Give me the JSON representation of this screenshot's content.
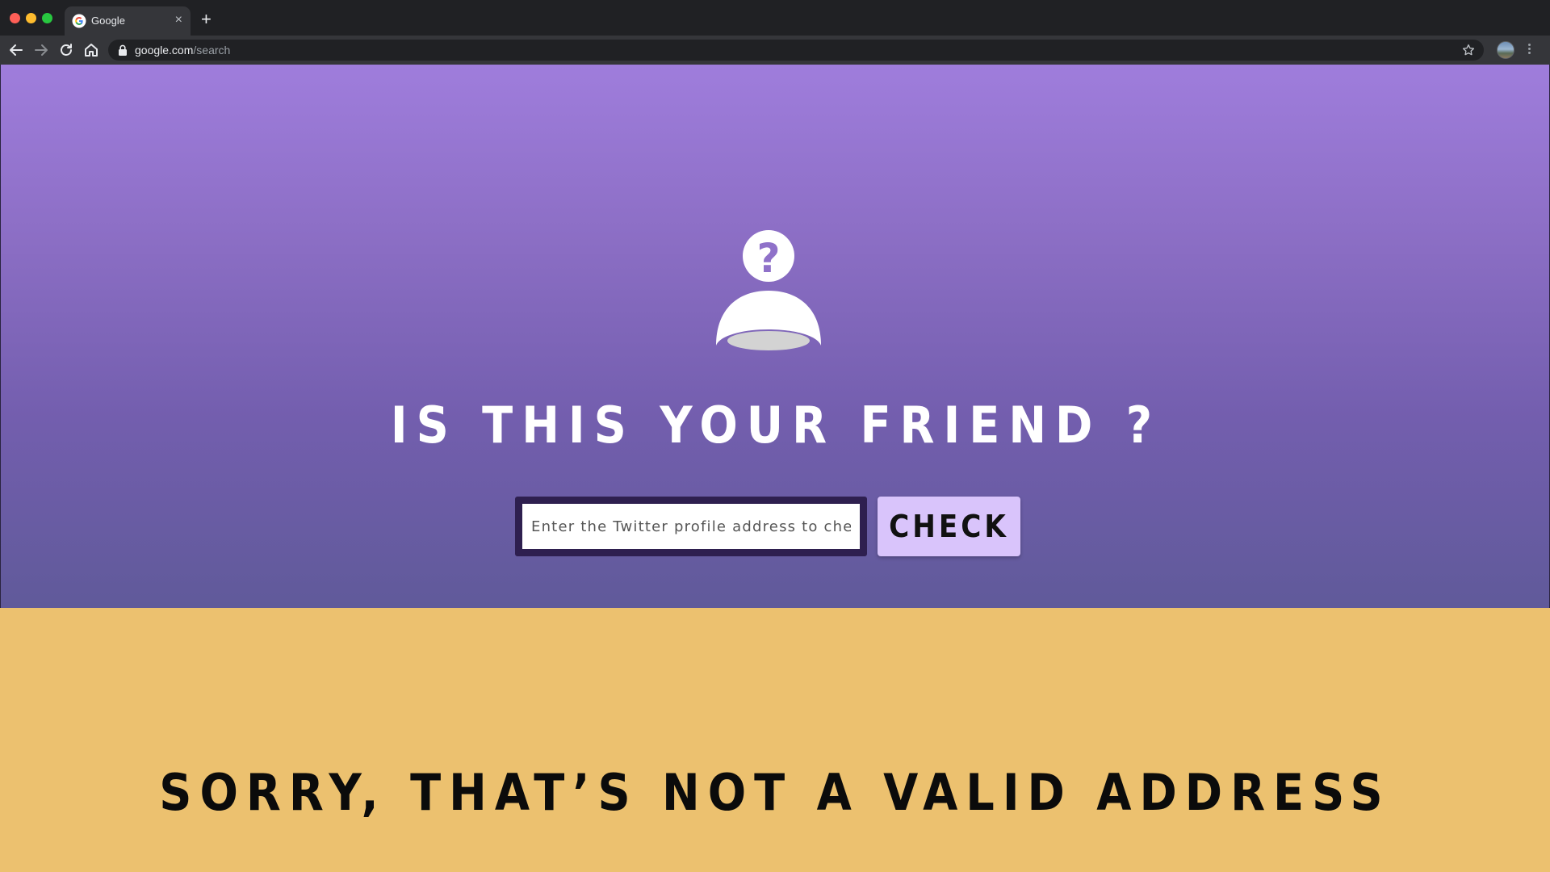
{
  "browser": {
    "tab_title": "Google",
    "tab_close": "×",
    "new_tab": "+",
    "url_host": "google.com",
    "url_path": "/search",
    "icons": [
      "google-favicon",
      "back-arrow-icon",
      "forward-arrow-icon",
      "reload-icon",
      "home-icon",
      "lock-icon",
      "star-icon",
      "profile-avatar",
      "menu-dots-icon"
    ]
  },
  "hero": {
    "icon": "unknown-person-question-icon",
    "question_mark": "?",
    "headline": "IS THIS YOUR FRIEND ?",
    "input_placeholder": "Enter the Twitter profile address to check",
    "input_value": "",
    "check_label": "CHECK",
    "gradient_top": "#9f7ddc",
    "gradient_bottom": "#605a9a",
    "input_border_color": "#2e1f4f",
    "button_color": "#d9c4fb"
  },
  "error": {
    "message": "SORRY, THAT’S NOT A VALID ADDRESS",
    "background": "#ecc16f"
  }
}
